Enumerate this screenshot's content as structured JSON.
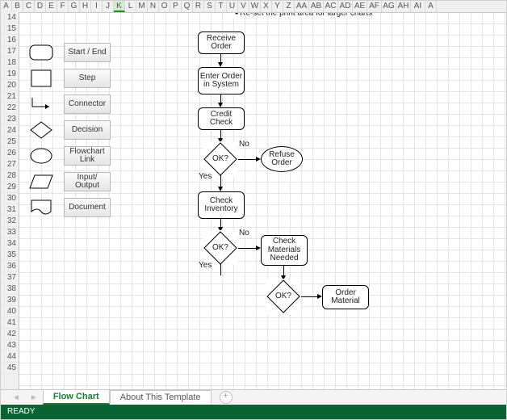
{
  "columns": [
    "A",
    "B",
    "C",
    "D",
    "E",
    "F",
    "G",
    "H",
    "I",
    "J",
    "K",
    "L",
    "M",
    "N",
    "O",
    "P",
    "Q",
    "R",
    "S",
    "T",
    "U",
    "V",
    "W",
    "X",
    "Y",
    "Z",
    "AA",
    "AB",
    "AC",
    "AD",
    "AE",
    "AF",
    "AG",
    "AH",
    "AI",
    "A"
  ],
  "selected_column": "K",
  "rows": [
    "14",
    "15",
    "16",
    "17",
    "18",
    "19",
    "20",
    "21",
    "22",
    "23",
    "24",
    "25",
    "26",
    "27",
    "28",
    "29",
    "30",
    "31",
    "32",
    "33",
    "34",
    "35",
    "36",
    "37",
    "38",
    "39",
    "40",
    "41",
    "42",
    "43",
    "44",
    "45"
  ],
  "note": "Re-set the print area for larger charts",
  "legend": [
    {
      "shape": "roundrect",
      "label": "Start / End"
    },
    {
      "shape": "square",
      "label": "Step"
    },
    {
      "shape": "connector",
      "label": "Connector"
    },
    {
      "shape": "diamond",
      "label": "Decision"
    },
    {
      "shape": "ellipse",
      "label": "Flowchart Link"
    },
    {
      "shape": "parallelogram",
      "label": "Input/ Output"
    },
    {
      "shape": "document",
      "label": "Document"
    }
  ],
  "flow": {
    "receive": "Receive Order",
    "enter": "Enter Order in System",
    "credit": "Credit Check",
    "ok1": "OK?",
    "ok1_no": "No",
    "ok1_yes": "Yes",
    "refuse": "Refuse Order",
    "check_inv": "Check Inventory",
    "ok2": "OK?",
    "ok2_no": "No",
    "ok2_yes": "Yes",
    "check_mat": "Check Materials Needed",
    "ok3": "OK?",
    "order_mat": "Order Material"
  },
  "tabs": {
    "active": "Flow Chart",
    "other": "About This Template"
  },
  "status": "READY"
}
